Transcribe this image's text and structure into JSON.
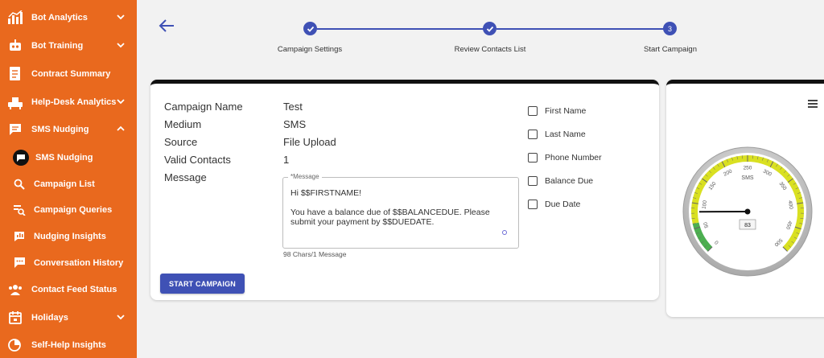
{
  "sidebar": {
    "items": [
      {
        "label": "Bot Analytics",
        "icon": "bar-chart-icon"
      },
      {
        "label": "Bot Training",
        "icon": "robot-icon"
      },
      {
        "label": "Contract Summary",
        "icon": "document-icon"
      },
      {
        "label": "Help-Desk Analytics",
        "icon": "desk-icon"
      },
      {
        "label": "SMS Nudging",
        "icon": "chat-icon"
      },
      {
        "label": "SMS Nudging",
        "icon": "chat-bubble-icon"
      },
      {
        "label": "Campaign List",
        "icon": "search-icon"
      },
      {
        "label": "Campaign Queries",
        "icon": "query-icon"
      },
      {
        "label": "Nudging Insights",
        "icon": "insights-icon"
      },
      {
        "label": "Conversation History",
        "icon": "chat-icon"
      },
      {
        "label": "Contact Feed Status",
        "icon": "contacts-icon"
      },
      {
        "label": "Holidays",
        "icon": "calendar-icon"
      },
      {
        "label": "Self-Help Insights",
        "icon": "insights-icon"
      }
    ]
  },
  "stepper": {
    "steps": [
      {
        "label": "Campaign Settings",
        "state": "done"
      },
      {
        "label": "Review Contacts List",
        "state": "done"
      },
      {
        "label": "Start Campaign",
        "state": "active",
        "number": "3"
      }
    ]
  },
  "campaign": {
    "labels": {
      "name": "Campaign Name",
      "medium": "Medium",
      "source": "Source",
      "valid_contacts": "Valid Contacts",
      "message": "Message"
    },
    "values": {
      "name": "Test",
      "medium": "SMS",
      "source": "File Upload",
      "valid_contacts": "1"
    },
    "message_legend": "*Message",
    "message_text": "Hi $$FIRSTNAME!\n\nYou have a balance due of $$BALANCEDUE. Please submit your payment by $$DUEDATE.",
    "message_count": "98 Chars/1 Message",
    "start_button": "START CAMPAIGN",
    "placeholders": [
      {
        "label": "First Name"
      },
      {
        "label": "Last Name"
      },
      {
        "label": "Phone Number"
      },
      {
        "label": "Balance Due"
      },
      {
        "label": "Due Date"
      }
    ]
  },
  "gauge": {
    "title": "SMS",
    "value": "83",
    "ticks": [
      "0",
      "50",
      "100",
      "150",
      "200",
      "250",
      "300",
      "350",
      "400",
      "450",
      "500"
    ]
  },
  "colors": {
    "sidebar": "#e9691e",
    "primary": "#3f51b5",
    "gauge_green": "#4caf50",
    "gauge_yellow": "#d9e021"
  }
}
